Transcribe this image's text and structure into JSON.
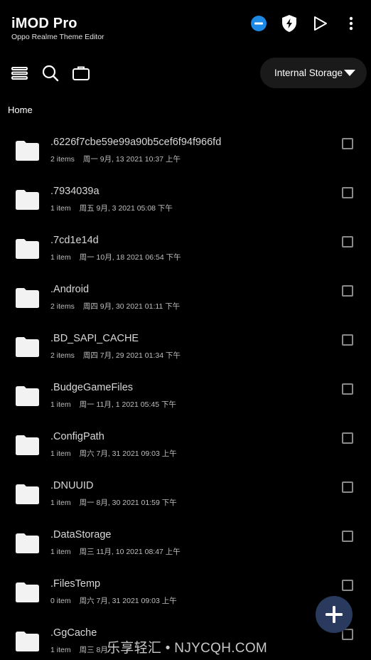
{
  "app": {
    "title": "iMOD Pro",
    "subtitle": "Oppo Realme Theme Editor"
  },
  "header_icons": [
    "minus-circle-icon",
    "shield-bolt-icon",
    "play-icon",
    "more-vertical-icon"
  ],
  "toolbar": {
    "icons": [
      "stack-icon",
      "search-icon",
      "briefcase-icon"
    ],
    "storage_label": "Internal Storage"
  },
  "breadcrumb": "Home",
  "files": [
    {
      "name": ".6226f7cbe59e99a90b5cef6f94f966fd",
      "count": "2 items",
      "date": "周一 9月, 13 2021 10:37 上午"
    },
    {
      "name": ".7934039a",
      "count": "1 item",
      "date": "周五 9月, 3 2021 05:08 下午"
    },
    {
      "name": ".7cd1e14d",
      "count": "1 item",
      "date": "周一 10月, 18 2021 06:54 下午"
    },
    {
      "name": ".Android",
      "count": "2 items",
      "date": "周四 9月, 30 2021 01:11 下午"
    },
    {
      "name": ".BD_SAPI_CACHE",
      "count": "2 items",
      "date": "周四 7月, 29 2021 01:34 下午"
    },
    {
      "name": ".BudgeGameFiles",
      "count": "1 item",
      "date": "周一 11月, 1 2021 05:45 下午"
    },
    {
      "name": ".ConfigPath",
      "count": "1 item",
      "date": "周六 7月, 31 2021 09:03 上午"
    },
    {
      "name": ".DNUUID",
      "count": "1 item",
      "date": "周一 8月, 30 2021 01:59 下午"
    },
    {
      "name": ".DataStorage",
      "count": "1 item",
      "date": "周三 11月, 10 2021 08:47 上午"
    },
    {
      "name": ".FilesTemp",
      "count": "0 item",
      "date": "周六 7月, 31 2021 09:03 上午"
    },
    {
      "name": ".GgCache",
      "count": "1 item",
      "date": "周三 8月"
    }
  ],
  "colors": {
    "background": "#000000",
    "fab": "#2a3a5e",
    "accent_blue": "#1e88e5",
    "storage_button": "#1a1a1a"
  },
  "watermark": "乐享轻汇 • NJYCQH.COM"
}
